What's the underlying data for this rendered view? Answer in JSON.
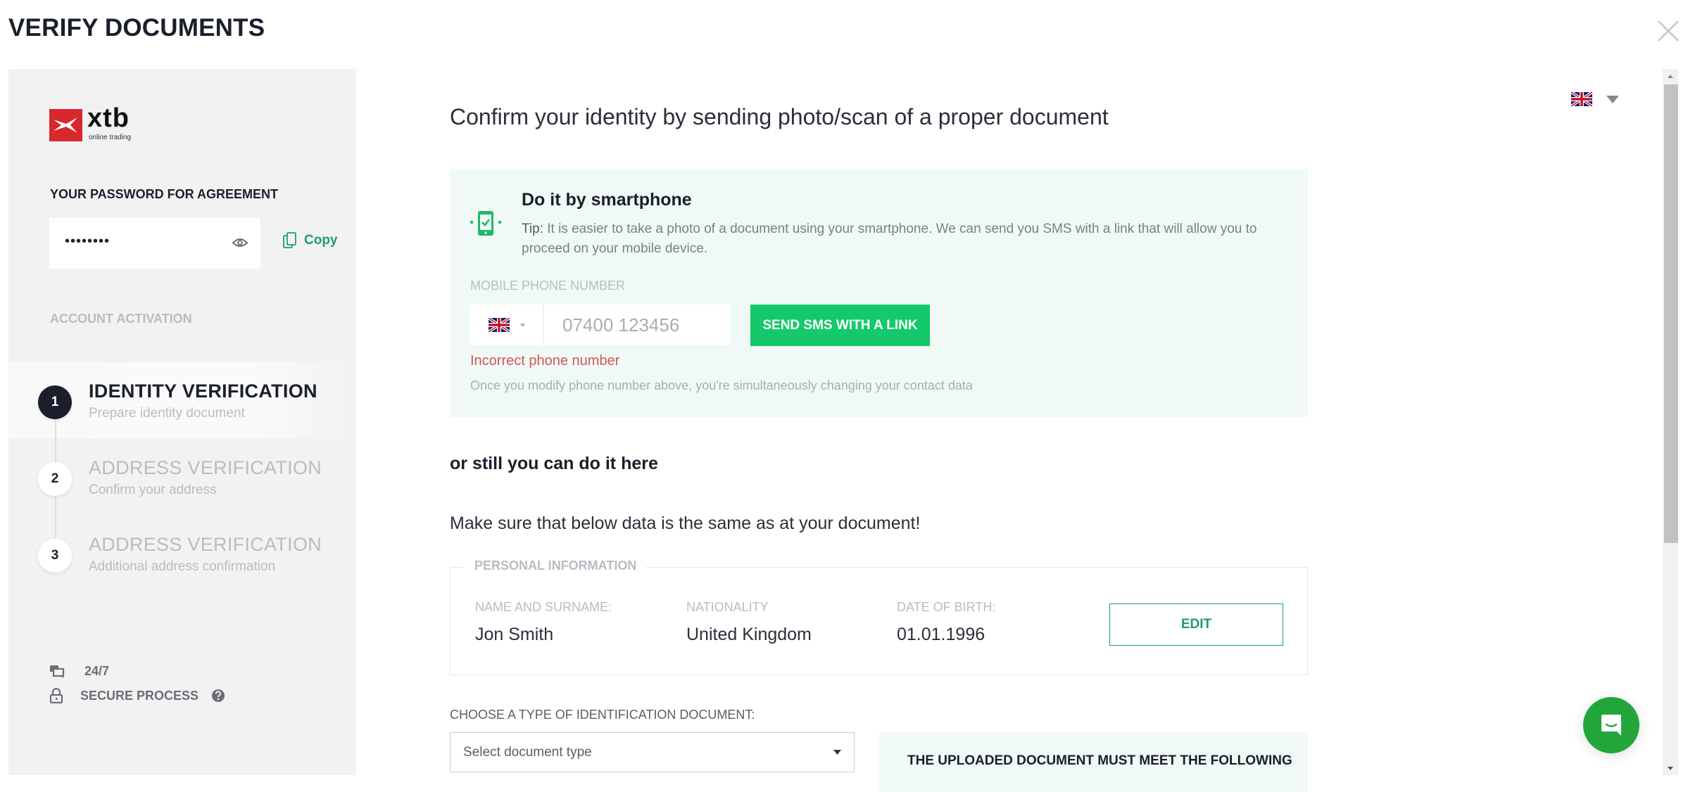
{
  "header": {
    "title": "VERIFY DOCUMENTS",
    "close_icon": "close-icon"
  },
  "sidebar": {
    "logo": {
      "brand": "xtb",
      "tagline": "online trading"
    },
    "password": {
      "label": "YOUR PASSWORD FOR AGREEMENT",
      "masked_value": "••••••••",
      "eye_icon": "eye-icon",
      "copy_label": "Copy",
      "copy_icon": "copy-icon"
    },
    "activation_label": "ACCOUNT ACTIVATION",
    "steps": [
      {
        "number": "1",
        "title": "IDENTITY VERIFICATION",
        "subtitle": "Prepare identity document",
        "active": true
      },
      {
        "number": "2",
        "title": "ADDRESS VERIFICATION",
        "subtitle": "Confirm your address",
        "active": false
      },
      {
        "number": "3",
        "title": "ADDRESS VERIFICATION",
        "subtitle": "Additional address confirmation",
        "active": false
      }
    ],
    "footer": [
      {
        "icon": "chat-bubbles-icon",
        "text": "24/7"
      },
      {
        "icon": "lock-icon",
        "text": "SECURE PROCESS",
        "help_icon": "question-circle-icon"
      }
    ]
  },
  "main": {
    "heading": "Confirm your identity by sending photo/scan of a proper document",
    "language": {
      "selected": "English (UK)",
      "flag": "uk-flag-icon"
    },
    "smartphone": {
      "title": "Do it by smartphone",
      "tip_prefix": "Tip:",
      "tip_text": " It is easier to take a photo of a document using your smartphone. We can send you SMS with a link that will allow you to proceed on your mobile device.",
      "phone_label": "MOBILE PHONE NUMBER",
      "country_flag": "uk-flag-icon",
      "phone_value": "",
      "phone_placeholder": "07400 123456",
      "send_button": "SEND SMS WITH A LINK",
      "error": "Incorrect phone number",
      "note": "Once you modify phone number above, you're simultaneously changing your contact data"
    },
    "or_here": "or still you can do it here",
    "make_sure": "Make sure that below data is the same as at your document!",
    "personal_info": {
      "legend": "PERSONAL INFORMATION",
      "fields": [
        {
          "label": "NAME AND SURNAME:",
          "value": "Jon Smith"
        },
        {
          "label": "NATIONALITY",
          "value": "United Kingdom"
        },
        {
          "label": "DATE OF BIRTH:",
          "value": "01.01.1996"
        }
      ],
      "edit_button": "EDIT"
    },
    "document_type": {
      "label": "CHOOSE A TYPE OF IDENTIFICATION DOCUMENT:",
      "placeholder": "Select document type"
    },
    "requirements_title": "THE UPLOADED DOCUMENT MUST MEET THE FOLLOWING"
  },
  "colors": {
    "accent_green": "#14c96b",
    "link_green": "#1f9d67",
    "error_red": "#d0575a",
    "brand_red": "#d9272e",
    "dark": "#1a1f2b",
    "sidebar_bg": "#f2f2f3",
    "panel_bg": "#f0f9f5"
  }
}
